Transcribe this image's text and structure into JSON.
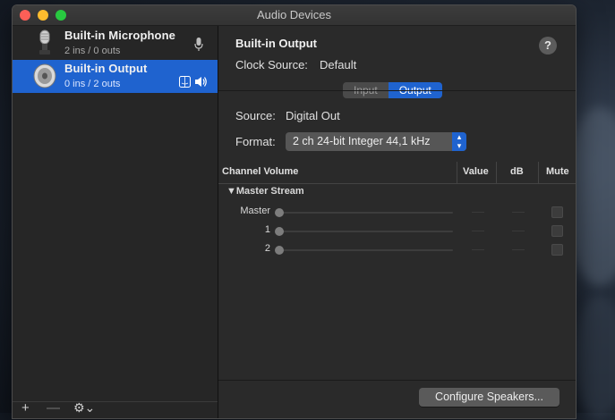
{
  "window": {
    "title": "Audio Devices"
  },
  "devices": [
    {
      "name": "Built-in Microphone",
      "io": "2 ins / 0 outs",
      "icon": "microphone-icon",
      "selected": false
    },
    {
      "name": "Built-in Output",
      "io": "0 ins / 2 outs",
      "icon": "speaker-icon",
      "selected": true
    }
  ],
  "sidebar_footer": {
    "add": "+",
    "remove": "—",
    "gear": "⚙⌄"
  },
  "detail": {
    "title": "Built-in Output",
    "help": "?",
    "clock_source_label": "Clock Source:",
    "clock_source_value": "Default",
    "tabs": {
      "input": "Input",
      "output": "Output",
      "active": "Output"
    },
    "source_label": "Source:",
    "source_value": "Digital Out",
    "format_label": "Format:",
    "format_value": "2 ch 24-bit Integer 44,1 kHz"
  },
  "table": {
    "headers": {
      "channel": "Channel Volume",
      "value": "Value",
      "db": "dB",
      "mute": "Mute"
    },
    "stream": "Master Stream",
    "rows": [
      {
        "label": "Master"
      },
      {
        "label": "1"
      },
      {
        "label": "2"
      }
    ]
  },
  "configure_button": "Configure Speakers..."
}
